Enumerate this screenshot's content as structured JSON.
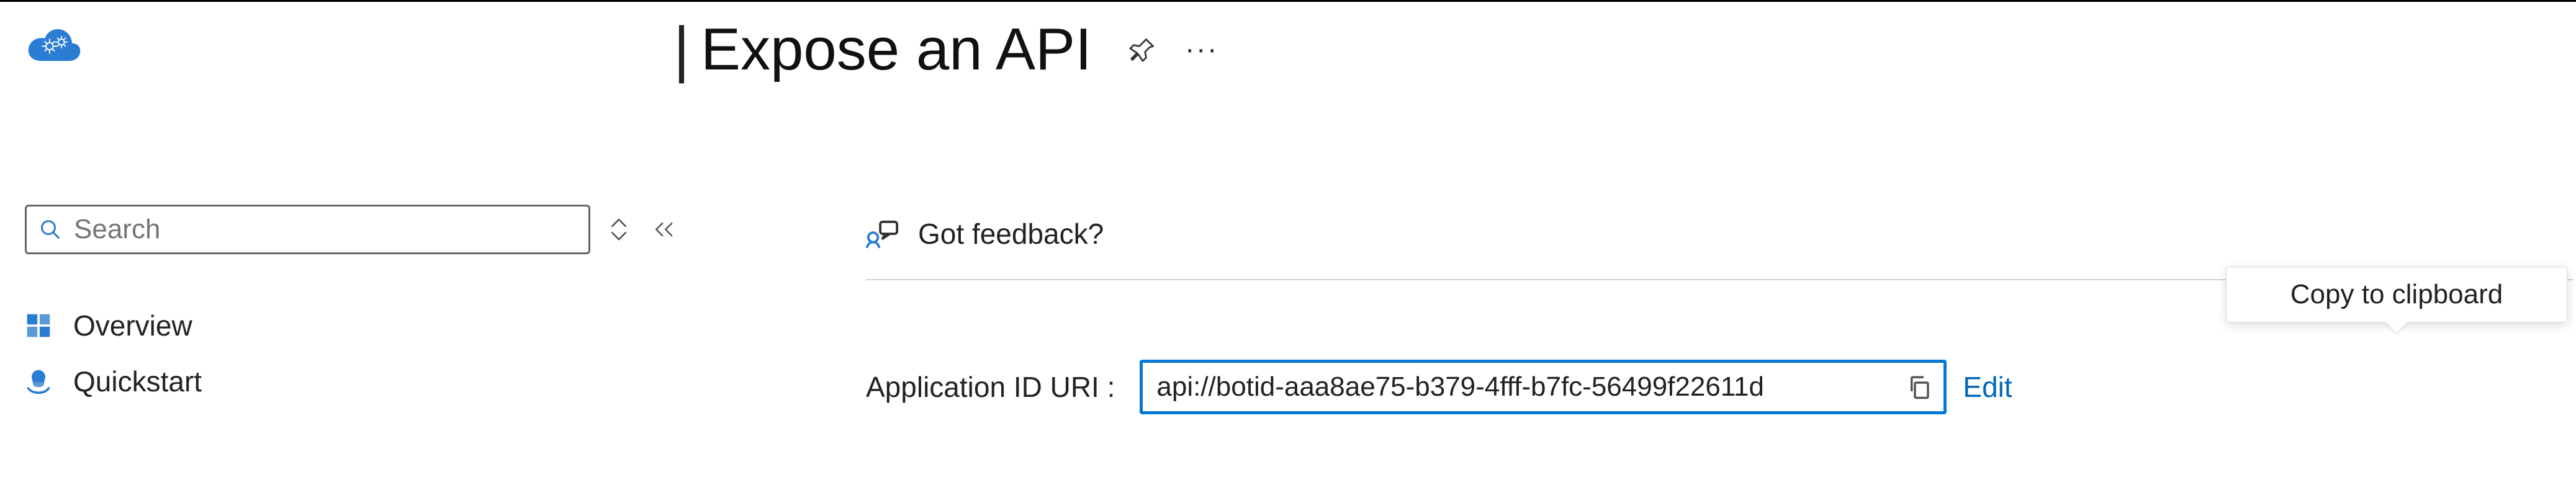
{
  "header": {
    "page_title": "Expose an API",
    "more": "···"
  },
  "search": {
    "placeholder": "Search"
  },
  "sidebar": {
    "items": [
      {
        "label": "Overview"
      },
      {
        "label": "Quickstart"
      }
    ]
  },
  "toolbar": {
    "feedback": "Got feedback?"
  },
  "uri": {
    "label": "Application ID URI :",
    "value": "api://botid-aaa8ae75-b379-4fff-b7fc-56499f22611d",
    "edit": "Edit"
  },
  "tooltip": {
    "copy": "Copy to clipboard"
  },
  "colors": {
    "accent": "#0078d4",
    "link": "#0067b8"
  }
}
